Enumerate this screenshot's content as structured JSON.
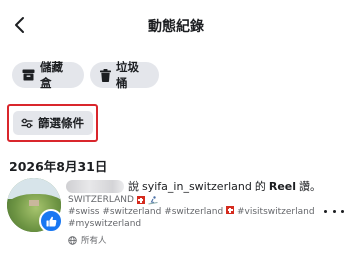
{
  "header": {
    "title": "動態紀錄",
    "back_icon": "chevron-left-icon"
  },
  "actions": {
    "archive_label": "儲藏盒",
    "archive_icon": "archive-box-icon",
    "trash_label": "垃圾桶",
    "trash_icon": "trash-can-icon"
  },
  "filter": {
    "label": "篩選條件",
    "icon": "sliders-icon",
    "highlight_color": "#d9262c"
  },
  "feed": {
    "date": "2026年8月31日",
    "activity": {
      "text_before": "說",
      "account": "syifa_in_switzerland",
      "connector": "的",
      "object": "Reel",
      "verb": "讚。",
      "badge_icon": "thumbs-up-icon",
      "badge_color": "#1877f2"
    },
    "post": {
      "title": "SWITZERLAND",
      "tags_1": "#swiss #switzerland #switzerland",
      "tags_2": "#visitswitzerland",
      "tags_3": "#myswitzerland"
    },
    "privacy": {
      "label": "所有人",
      "icon": "globe-icon"
    },
    "more_icon": "more-horizontal-icon"
  }
}
